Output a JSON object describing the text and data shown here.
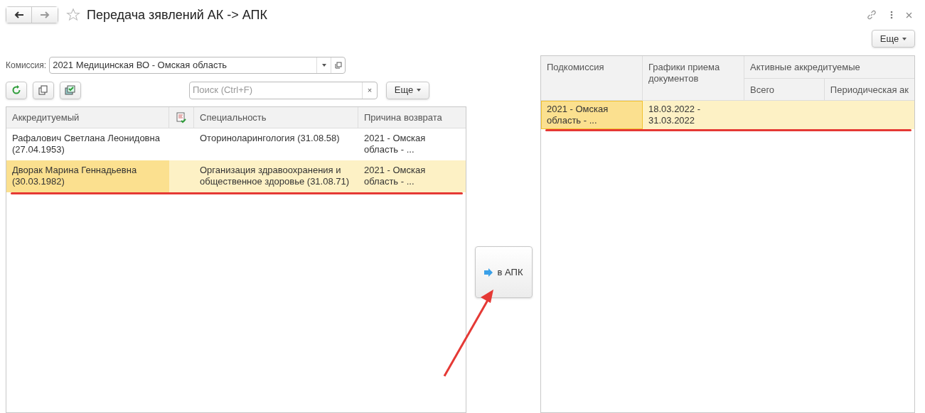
{
  "window": {
    "title": "Передача зявлений АК -> АПК"
  },
  "commission": {
    "label": "Комиссия:",
    "value": "2021 Медицинская ВО - Омская область"
  },
  "search": {
    "placeholder": "Поиск (Ctrl+F)",
    "clear": "×"
  },
  "more_button_left": "Еще",
  "more_button_right": "Еще",
  "left_table": {
    "columns": [
      "Аккредитуемый",
      "Специальность",
      "Причина возврата"
    ],
    "rows": [
      {
        "person": "Рафалович Светлана Леонидовна (27.04.1953)",
        "specialty": "Оториноларингология (31.08.58)",
        "reason": "2021 - Омская область - ...",
        "selected": false
      },
      {
        "person": "Дворак Марина Геннадьевна (30.03.1982)",
        "specialty": "Организация здравоохранения и общественное здоровье (31.08.71)",
        "reason": "2021 - Омская область - ...",
        "selected": true
      }
    ]
  },
  "transfer_button": "в АПК",
  "right_table": {
    "columns": [
      "Подкомиссия",
      "Графики приема документов"
    ],
    "group": "Активные аккредитуемые",
    "subcolumns": [
      "Всего",
      "Периодическая ак"
    ],
    "rows": [
      {
        "subcommission": "2021 - Омская область - ...",
        "schedule": "18.03.2022 - 31.03.2022",
        "selected": true
      }
    ]
  }
}
